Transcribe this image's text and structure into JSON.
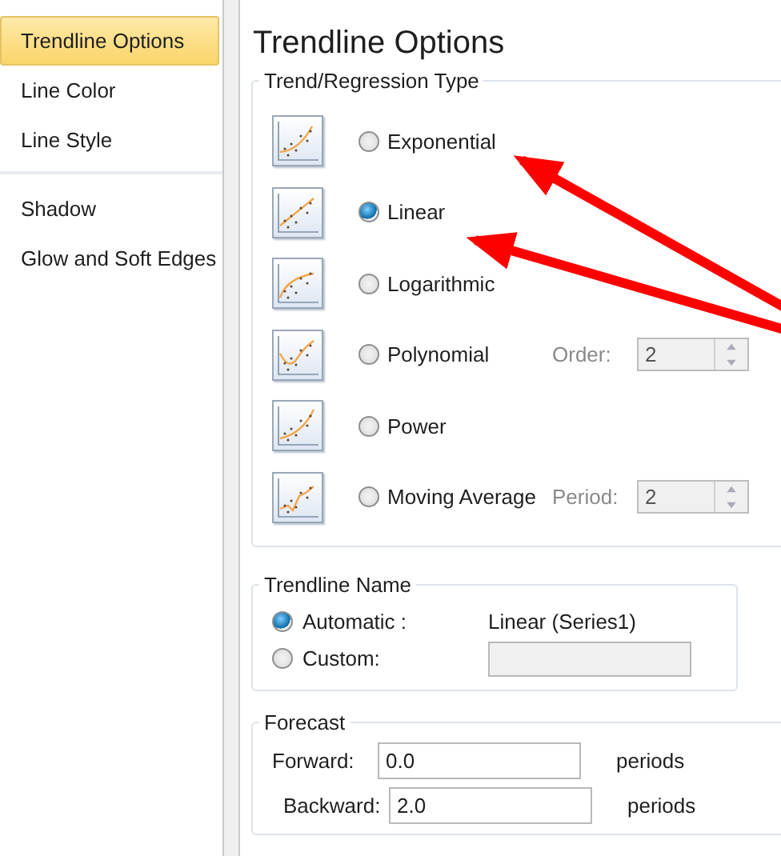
{
  "sidebar": {
    "items": [
      {
        "label": "Trendline Options",
        "selected": true,
        "group_end": false
      },
      {
        "label": "Line Color",
        "selected": false,
        "group_end": false
      },
      {
        "label": "Line Style",
        "selected": false,
        "group_end": true
      },
      {
        "label": "Shadow",
        "selected": false,
        "group_end": false
      },
      {
        "label": "Glow and Soft Edges",
        "selected": false,
        "group_end": false
      }
    ]
  },
  "panel": {
    "title": "Trendline Options",
    "regression": {
      "legend": "Trend/Regression Type",
      "types": [
        {
          "label": "Exponential",
          "selected": false
        },
        {
          "label": "Linear",
          "selected": true
        },
        {
          "label": "Logarithmic",
          "selected": false
        },
        {
          "label": "Polynomial",
          "selected": false,
          "param": {
            "label": "Order:",
            "value": "2",
            "disabled": true
          }
        },
        {
          "label": "Power",
          "selected": false
        },
        {
          "label": "Moving Average",
          "selected": false,
          "param": {
            "label": "Period:",
            "value": "2",
            "disabled": true
          }
        }
      ]
    },
    "trendline_name": {
      "legend": "Trendline Name",
      "options": [
        {
          "label": "Automatic :",
          "selected": true,
          "value": "Linear (Series1)"
        },
        {
          "label": "Custom:",
          "selected": false,
          "field_disabled": true
        }
      ]
    },
    "forecast": {
      "legend": "Forecast",
      "rows": [
        {
          "label": "Forward:",
          "value": "0.0",
          "unit": "periods"
        },
        {
          "label": "Backward:",
          "value": "2.0",
          "unit": "periods"
        }
      ]
    }
  },
  "annotations": {
    "arrows": [
      {
        "kind": "arrow"
      },
      {
        "kind": "arrow"
      }
    ]
  }
}
